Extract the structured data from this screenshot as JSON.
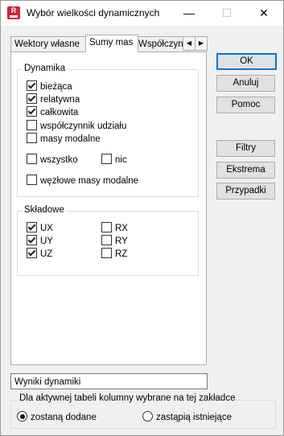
{
  "window": {
    "title": "Wybór wielkości dynamicznych"
  },
  "tabs": [
    {
      "label": "Wektory własne"
    },
    {
      "label": "Sumy mas"
    },
    {
      "label": "Współczynn"
    }
  ],
  "dynamika": {
    "title": "Dynamika",
    "items": [
      {
        "label": "bieżąca",
        "checked": true
      },
      {
        "label": "relatywna",
        "checked": true
      },
      {
        "label": "całkowita",
        "checked": true
      },
      {
        "label": "współczynnik udziału",
        "checked": false
      },
      {
        "label": "masy modalne",
        "checked": false
      }
    ],
    "all_label": "wszystko",
    "none_label": "nic",
    "nodal_label": "węzłowe masy modalne"
  },
  "skladowe": {
    "title": "Składowe",
    "left": [
      {
        "label": "UX",
        "checked": true
      },
      {
        "label": "UY",
        "checked": true
      },
      {
        "label": "UZ",
        "checked": true
      }
    ],
    "right": [
      {
        "label": "RX",
        "checked": false
      },
      {
        "label": "RY",
        "checked": false
      },
      {
        "label": "RZ",
        "checked": false
      }
    ]
  },
  "buttons": {
    "ok": "OK",
    "cancel": "Anuluj",
    "help": "Pomoc",
    "filters": "Filtry",
    "extremes": "Ekstrema",
    "cases": "Przypadki"
  },
  "table_name": "Wyniki dynamiki",
  "columns_group": {
    "title": "Dla aktywnej tabeli kolumny wybrane na tej zakładce",
    "option_add": "zostaną dodane",
    "option_replace": "zastąpią istniejące",
    "selected": "add"
  }
}
